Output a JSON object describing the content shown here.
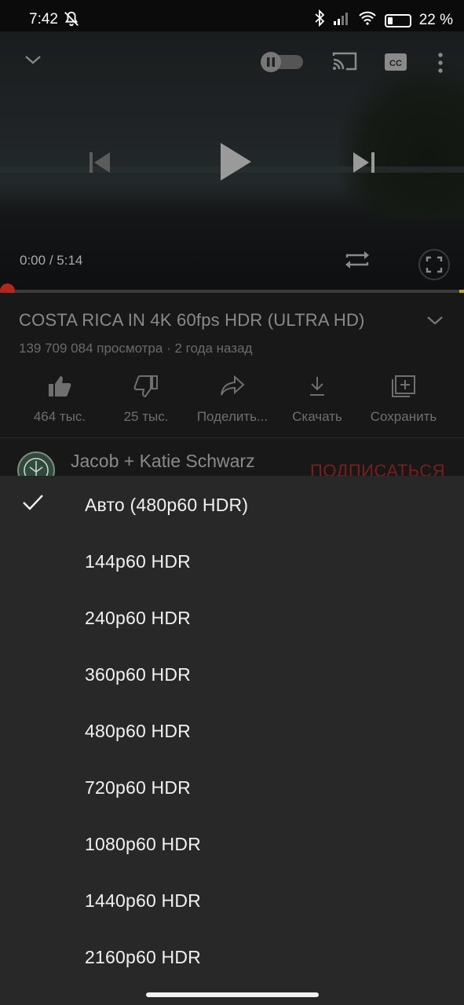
{
  "status_bar": {
    "time": "7:42",
    "battery": "22 %",
    "battery_level": 0.22
  },
  "player": {
    "current_time": "0:00",
    "separator": " / ",
    "duration": "5:14",
    "progress": 0.0,
    "icons": [
      "collapse-chevron-icon",
      "autoplay-toggle-icon",
      "cast-icon",
      "captions-icon",
      "more-icon",
      "previous-icon",
      "play-icon",
      "next-icon",
      "loop-icon",
      "fullscreen-icon"
    ]
  },
  "video": {
    "title": "COSTA RICA IN 4K 60fps HDR (ULTRA HD)",
    "meta": "139 709 084 просмотра · 2 года назад"
  },
  "actions": [
    {
      "id": "like",
      "label": "464 тыс.",
      "icon": "thumb-up-icon"
    },
    {
      "id": "dislike",
      "label": "25 тыс.",
      "icon": "thumb-down-icon"
    },
    {
      "id": "share",
      "label": "Поделить...",
      "icon": "share-icon"
    },
    {
      "id": "download",
      "label": "Скачать",
      "icon": "download-icon"
    },
    {
      "id": "save",
      "label": "Сохранить",
      "icon": "save-playlist-icon"
    }
  ],
  "channel": {
    "name": "Jacob + Katie Schwarz",
    "subscribe": "ПОДПИСАТЬСЯ"
  },
  "quality_menu": {
    "selected_index": 0,
    "options": [
      "Авто (480p60 HDR)",
      "144p60 HDR",
      "240p60 HDR",
      "360p60 HDR",
      "480p60 HDR",
      "720p60 HDR",
      "1080p60 HDR",
      "1440p60 HDR",
      "2160p60 HDR"
    ]
  },
  "colors": {
    "accent": "#b3261e",
    "sheet_bg": "#282828",
    "text": "#f1f1f1"
  }
}
